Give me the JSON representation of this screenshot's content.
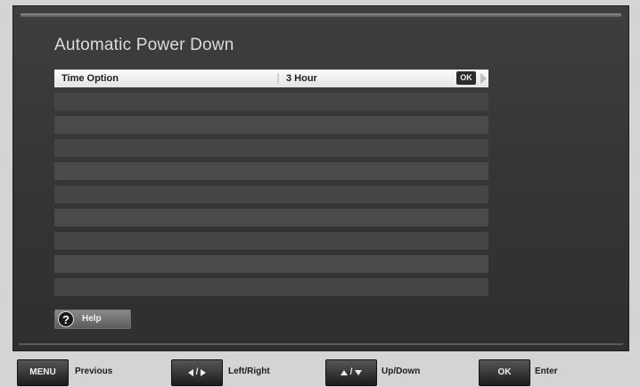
{
  "screen": {
    "title": "Automatic Power Down"
  },
  "option_row": {
    "label": "Time Option",
    "value": "3 Hour",
    "ok_badge": "OK",
    "arrow_icon": "chevron-right-icon"
  },
  "help": {
    "icon_glyph": "?",
    "label": "Help"
  },
  "footer": {
    "menu_key": "MENU",
    "menu_label": "Previous",
    "leftright_sep": "/",
    "leftright_label": "Left/Right",
    "updown_sep": "/",
    "updown_label": "Up/Down",
    "ok_key": "OK",
    "ok_label": "Enter"
  },
  "colors": {
    "screen_bg": "#3a3a3a",
    "selected_row": "#f2f2f2",
    "empty_row": "#4a4a4a",
    "page_bg": "#d4d4d4"
  }
}
